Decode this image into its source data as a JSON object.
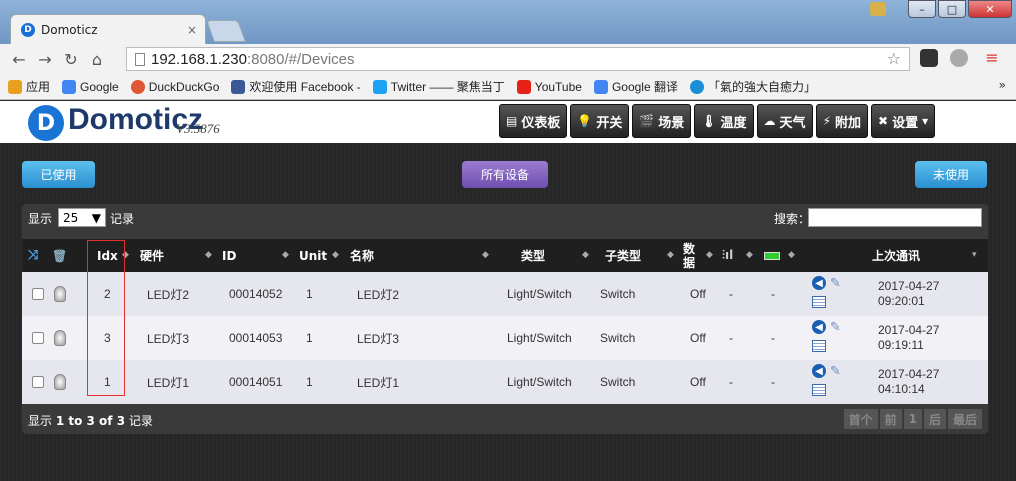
{
  "browser": {
    "tab_title": "Domoticz",
    "tab_close": "×",
    "url_host": "192.168.1.230",
    "url_path": ":8080/#/Devices",
    "window_buttons": {
      "minimize": "–",
      "maximize": "□",
      "close": "✕"
    },
    "bookmarks": [
      {
        "label": "应用",
        "color": "#e8a020"
      },
      {
        "label": "Google",
        "color": "#4285f4"
      },
      {
        "label": "DuckDuckGo",
        "color": "#de5833"
      },
      {
        "label": "欢迎使用 Facebook -",
        "color": "#3b5998"
      },
      {
        "label": "Twitter —— 聚焦当丁",
        "color": "#1da1f2"
      },
      {
        "label": "YouTube",
        "color": "#e62117"
      },
      {
        "label": "Google 翻译",
        "color": "#4285f4"
      },
      {
        "label": "「氣的強大自癒力」",
        "color": "#1a8fd6"
      }
    ],
    "bookmarks_more": "»"
  },
  "app": {
    "logo_text": "Domoticz",
    "version": "V3.5876",
    "menu": [
      {
        "label": "仪表板",
        "icon": "dashboard-icon",
        "glyph": "▤"
      },
      {
        "label": "开关",
        "icon": "bulb-icon",
        "glyph": "💡"
      },
      {
        "label": "场景",
        "icon": "scene-icon",
        "glyph": "🎬"
      },
      {
        "label": "温度",
        "icon": "thermometer-icon",
        "glyph": "🌡"
      },
      {
        "label": "天气",
        "icon": "weather-icon",
        "glyph": "☁"
      },
      {
        "label": "附加",
        "icon": "utility-icon",
        "glyph": "⚡"
      },
      {
        "label": "设置",
        "icon": "settings-icon",
        "glyph": "✖",
        "dropdown": "▾"
      }
    ]
  },
  "filters": {
    "used": "已使用",
    "all": "所有设备",
    "unused": "未使用"
  },
  "table_controls": {
    "show_label": "显示",
    "page_length": "25",
    "records_label": "记录",
    "search_label": "搜索："
  },
  "columns": [
    {
      "key": "idx",
      "label": "Idx"
    },
    {
      "key": "hardware",
      "label": "硬件"
    },
    {
      "key": "id",
      "label": "ID"
    },
    {
      "key": "unit",
      "label": "Unit"
    },
    {
      "key": "name",
      "label": "名称"
    },
    {
      "key": "type",
      "label": "类型"
    },
    {
      "key": "subtype",
      "label": "子类型"
    },
    {
      "key": "data",
      "label": "数据"
    },
    {
      "key": "last_seen",
      "label": "上次通讯"
    }
  ],
  "rows": [
    {
      "idx": "2",
      "hardware": "LED灯2",
      "id": "00014052",
      "unit": "1",
      "name": "LED灯2",
      "type": "Light/Switch",
      "subtype": "Switch",
      "data": "Off",
      "signal": "-",
      "battery": "-",
      "date": "2017-04-27",
      "time": "09:20:01"
    },
    {
      "idx": "3",
      "hardware": "LED灯3",
      "id": "00014053",
      "unit": "1",
      "name": "LED灯3",
      "type": "Light/Switch",
      "subtype": "Switch",
      "data": "Off",
      "signal": "-",
      "battery": "-",
      "date": "2017-04-27",
      "time": "09:19:11"
    },
    {
      "idx": "1",
      "hardware": "LED灯1",
      "id": "00014051",
      "unit": "1",
      "name": "LED灯1",
      "type": "Light/Switch",
      "subtype": "Switch",
      "data": "Off",
      "signal": "-",
      "battery": "-",
      "date": "2017-04-27",
      "time": "04:10:14"
    }
  ],
  "footer": {
    "info_prefix": "显示",
    "info_range": "1 to 3 of 3",
    "info_suffix": "记录",
    "pager": [
      "首个",
      "前",
      "1",
      "后",
      "最后"
    ]
  },
  "colors": {
    "accent_blue": "#2a8fd0",
    "accent_purple": "#6f4fb0",
    "highlight_red": "#e03030"
  }
}
